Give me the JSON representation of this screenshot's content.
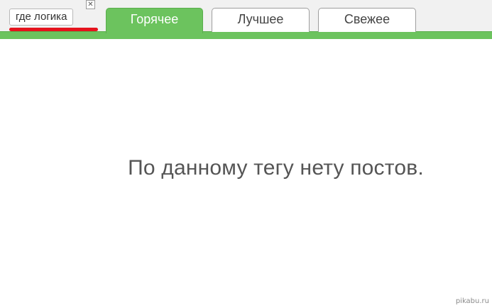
{
  "tag_filter": {
    "label": "где логика",
    "close_glyph": "✕",
    "close_icon": "close-icon",
    "underline_color": "#e5131d"
  },
  "tabs": [
    {
      "label": "Горячее",
      "active": true
    },
    {
      "label": "Лучшее",
      "active": false
    },
    {
      "label": "Свежее",
      "active": false
    }
  ],
  "colors": {
    "accent_green": "#6cc35e"
  },
  "main": {
    "empty_message": "По данному тегу нету постов."
  },
  "watermark": "pikabu.ru"
}
